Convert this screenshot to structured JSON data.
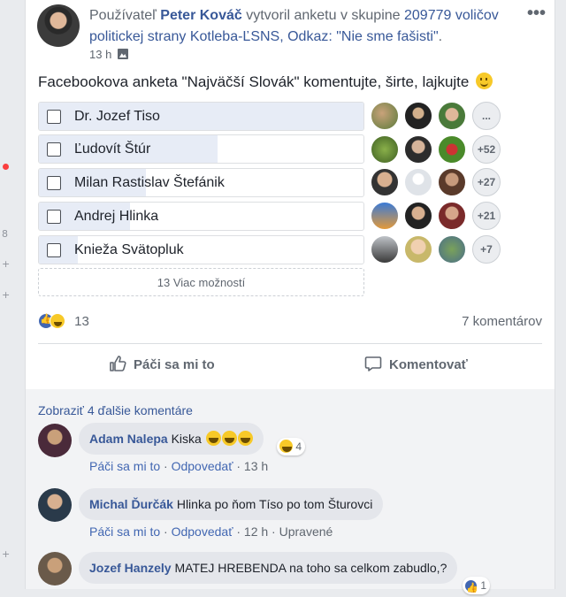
{
  "left_strip": [
    "8",
    "+",
    "+",
    "+"
  ],
  "post": {
    "prefix": "Používateľ",
    "author": "Peter Kováč",
    "action": "vytvoril anketu v skupine",
    "group": "209779 voličov politickej strany Kotleba-ĽSNS, Odkaz: \"Nie sme fašisti\"",
    "end": ".",
    "time": "13 h",
    "status": "Facebookova anketa \"Najväčší Slovák\" komentujte, širte, lajkujte",
    "options": [
      {
        "label": "Dr. Jozef Tiso",
        "fill": 1.0,
        "more": "..."
      },
      {
        "label": "Ľudovít Štúr",
        "fill": 0.55,
        "more": "+52"
      },
      {
        "label": "Milan Rastislav Štefánik",
        "fill": 0.33,
        "more": "+27"
      },
      {
        "label": "Andrej Hlinka",
        "fill": 0.28,
        "more": "+21"
      },
      {
        "label": "Knieža Svätopluk",
        "fill": 0.12,
        "more": "+7"
      }
    ],
    "more_options": "13 Viac možností",
    "reaction_count": "13",
    "comments_count": "7 komentárov",
    "like_label": "Páči sa mi to",
    "comment_label": "Komentovať"
  },
  "comments": {
    "view_more": "Zobraziť 4 ďalšie komentáre",
    "items": [
      {
        "author": "Adam Nalepa",
        "text": "Kiska",
        "like": "Páči sa mi to",
        "reply": "Odpovedať",
        "time": "13 h",
        "edited": "",
        "reaction_count": "4"
      },
      {
        "author": "Michal Ďurčák",
        "text": "Hlinka po ňom Tíso po tom Šturovci",
        "like": "Páči sa mi to",
        "reply": "Odpovedať",
        "time": "12 h",
        "edited": "Upravené",
        "reaction_count": ""
      },
      {
        "author": "Jozef Hanzely",
        "text": "MATEJ HREBENDA na toho sa celkom zabudlo,?",
        "like": "",
        "reply": "",
        "time": "",
        "edited": "",
        "reaction_count": "1"
      }
    ],
    "separator": "·"
  },
  "colors": {
    "link": "#385898",
    "muted": "#606770",
    "poll_fill": "#e7ecf6",
    "like": "#4267b2",
    "haha": "#f7c928"
  }
}
